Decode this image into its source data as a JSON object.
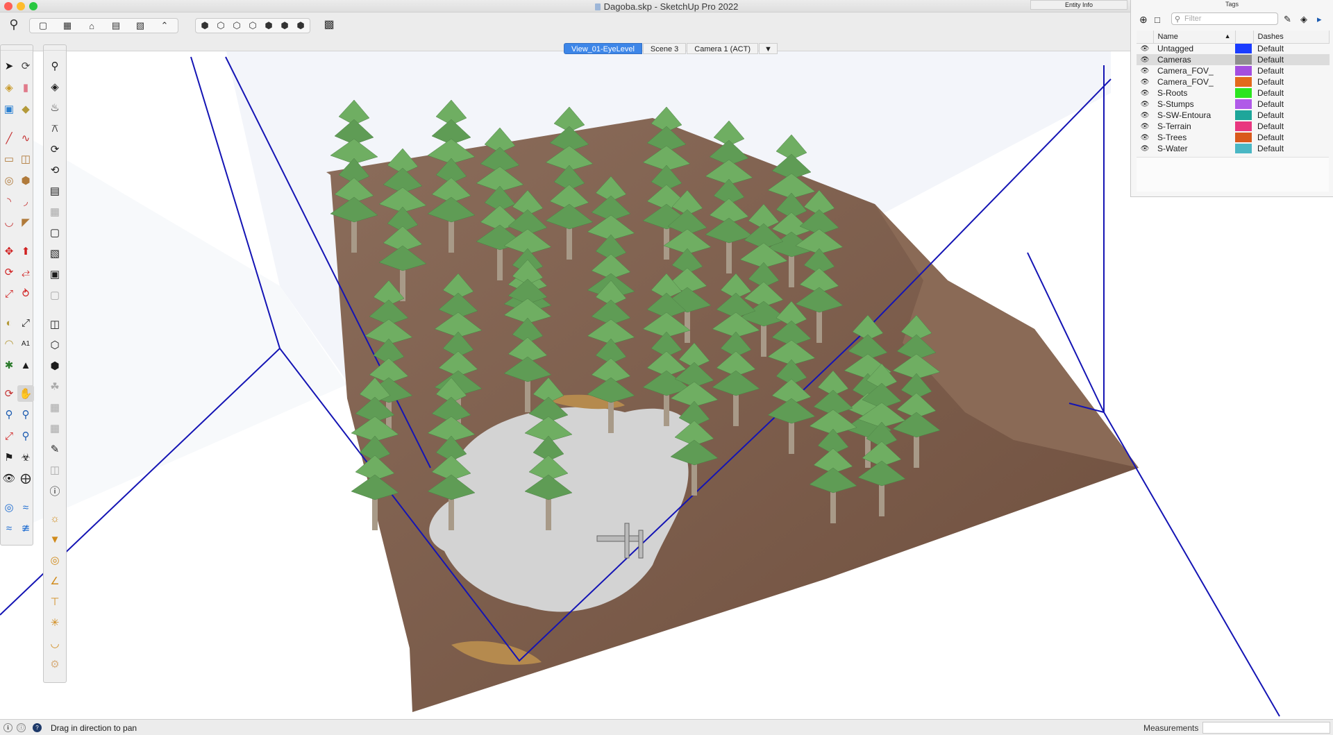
{
  "window": {
    "title": "Dagoba.skp - SketchUp Pro 2022",
    "traffic_colors": [
      "#fe5f57",
      "#febc2e",
      "#28c840"
    ]
  },
  "toolbar": {
    "icons": [
      "search-icon",
      "components-icon",
      "warehouse-icon",
      "home-icon",
      "styles-icon",
      "scenes-icon",
      "house-icon",
      "iso-view-icon",
      "top-view-icon",
      "front-view-icon",
      "right-view-icon",
      "back-view-icon",
      "left-view-icon",
      "bottom-view-icon",
      "display-icon"
    ]
  },
  "scenes": {
    "tabs": [
      "View_01-EyeLevel",
      "Scene 3",
      "Camera 1 (ACT)"
    ],
    "active_index": 0,
    "more_glyph": "▼"
  },
  "entity_info": {
    "title": "Entity Info"
  },
  "tags_panel": {
    "title": "Tags",
    "filter_placeholder": "Filter",
    "columns": {
      "name": "Name",
      "dashes": "Dashes"
    },
    "rows": [
      {
        "name": "Untagged",
        "color": "#1a3cff",
        "dashes": "Default",
        "selected": false
      },
      {
        "name": "Cameras",
        "color": "#8f8f8f",
        "dashes": "Default",
        "selected": true
      },
      {
        "name": "Camera_FOV_",
        "color": "#a44ee0",
        "dashes": "Default",
        "selected": false
      },
      {
        "name": "Camera_FOV_",
        "color": "#e36a1c",
        "dashes": "Default",
        "selected": false
      },
      {
        "name": "S-Roots",
        "color": "#2ce520",
        "dashes": "Default",
        "selected": false
      },
      {
        "name": "S-Stumps",
        "color": "#b05ae8",
        "dashes": "Default",
        "selected": false
      },
      {
        "name": "S-SW-Entoura",
        "color": "#1ea69a",
        "dashes": "Default",
        "selected": false
      },
      {
        "name": "S-Terrain",
        "color": "#e8377f",
        "dashes": "Default",
        "selected": false
      },
      {
        "name": "S-Trees",
        "color": "#d9591b",
        "dashes": "Default",
        "selected": false
      },
      {
        "name": "S-Water",
        "color": "#4ab7c4",
        "dashes": "Default",
        "selected": false
      }
    ]
  },
  "statusbar": {
    "message": "Drag in direction to pan",
    "measurements_label": "Measurements",
    "measurements_value": ""
  },
  "scene": {
    "terrain_color": "#7a5a48",
    "water_color": "#d4d4d4",
    "foliage_color": "#6fae62",
    "guide_line_color": "#1414b4"
  }
}
